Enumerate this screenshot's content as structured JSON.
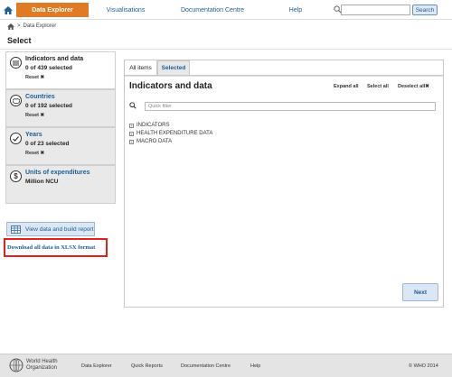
{
  "topnav": {
    "home_icon": "home-icon",
    "tabs": [
      "Data Explorer",
      "Visualisations",
      "Documentation Centre",
      "Help"
    ],
    "search_placeholder": "",
    "search_button": "Search",
    "accent_color": "#e07b24"
  },
  "breadcrumb": {
    "home_icon": "home-icon",
    "separator": ">",
    "current": "Data Explorer"
  },
  "page_title": "Select",
  "dimensions": [
    {
      "title": "Indicators and data",
      "count": "0 of 439 selected",
      "reset": "Reset",
      "icon": "list-icon"
    },
    {
      "title": "Countries",
      "count": "0 of 192 selected",
      "reset": "Reset",
      "icon": "map-icon"
    },
    {
      "title": "Years",
      "count": "0 of 23 selected",
      "reset": "Reset",
      "icon": "check-icon"
    },
    {
      "title": "Units of expenditures",
      "count": "Million NCU",
      "icon": "dollar-icon"
    }
  ],
  "view_button": "View data and build report",
  "download_link": "Download all data in XLSX format",
  "main": {
    "tabs": [
      "All items",
      "Selected"
    ],
    "section_title": "Indicators and data",
    "actions": [
      "Expand all",
      "Select all",
      "Deselect all"
    ],
    "filter_placeholder": "Quick filter",
    "tree": [
      "INDICATORS",
      "HEALTH EXPENDITURE DATA",
      "MACRO DATA"
    ],
    "next_button": "Next"
  },
  "footer": {
    "org_line1": "World Health",
    "org_line2": "Organization",
    "links": [
      "Data Explorer",
      "Quick Reports",
      "Documentation Centre",
      "Help"
    ],
    "copyright": "© WHO 2014"
  }
}
